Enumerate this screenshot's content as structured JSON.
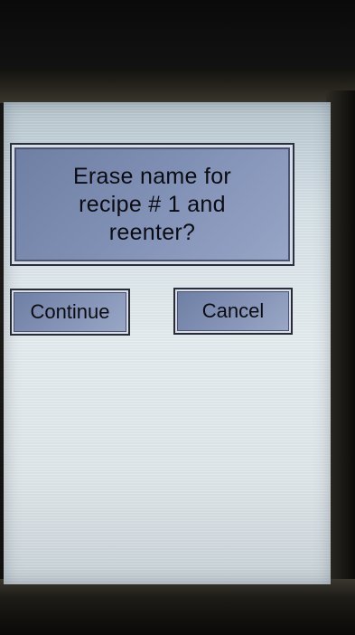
{
  "dialog": {
    "message": "Erase name for\nrecipe #    1  and\nreenter?"
  },
  "buttons": {
    "continue_label": "Continue",
    "cancel_label": "Cancel"
  },
  "colors": {
    "panel_fill": "#7f8fb4",
    "panel_border": "#d7dde6",
    "screen_background": "#dfe6ea"
  }
}
